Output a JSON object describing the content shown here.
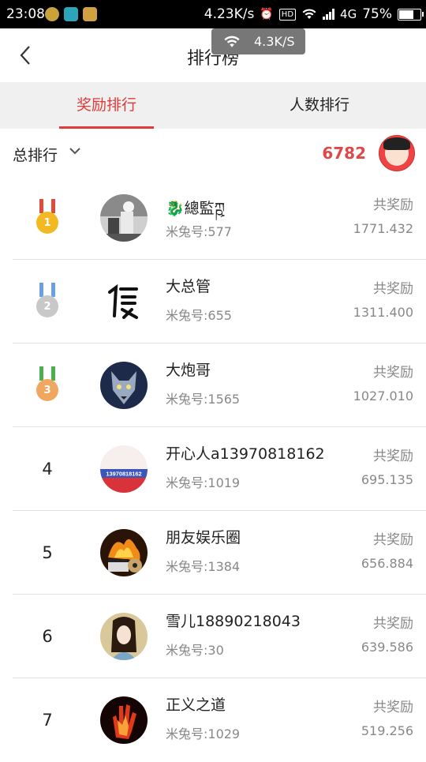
{
  "status_bar": {
    "time": "23:08",
    "net_speed": "4.23K/s",
    "network": "4G",
    "battery": "75%",
    "battery_level": 0.75
  },
  "toast": {
    "speed": "4.3K/S",
    "icon": "wifi-icon"
  },
  "header": {
    "title": "排行榜",
    "back_icon": "chevron-left-icon"
  },
  "tabs": [
    {
      "label": "奖励排行",
      "active": true
    },
    {
      "label": "人数排行",
      "active": false
    }
  ],
  "filter": {
    "label": "总排行",
    "icon": "chevron-down-icon"
  },
  "my": {
    "score": "6782"
  },
  "colors": {
    "accent": "#e03a3a",
    "score": "#e04848"
  },
  "list": {
    "reward_label": "共奖励",
    "items": [
      {
        "rank": "1",
        "medal": "gold",
        "name": "🐉總監ཀྵ",
        "uid": "米兔号:577",
        "reward": "1771.432"
      },
      {
        "rank": "2",
        "medal": "silver",
        "name": "大总管",
        "uid": "米兔号:655",
        "reward": "1311.400"
      },
      {
        "rank": "3",
        "medal": "bronze",
        "name": "大炮哥",
        "uid": "米兔号:1565",
        "reward": "1027.010"
      },
      {
        "rank": "4",
        "medal": null,
        "name": "开心人a13970818162",
        "uid": "米兔号:1019",
        "reward": "695.135",
        "avatar_text": "13970818162"
      },
      {
        "rank": "5",
        "medal": null,
        "name": "朋友娱乐圈",
        "uid": "米兔号:1384",
        "reward": "656.884"
      },
      {
        "rank": "6",
        "medal": null,
        "name": "雪儿18890218043",
        "uid": "米兔号:30",
        "reward": "639.586"
      },
      {
        "rank": "7",
        "medal": null,
        "name": "正义之道",
        "uid": "米兔号:1029",
        "reward": "519.256"
      }
    ]
  }
}
